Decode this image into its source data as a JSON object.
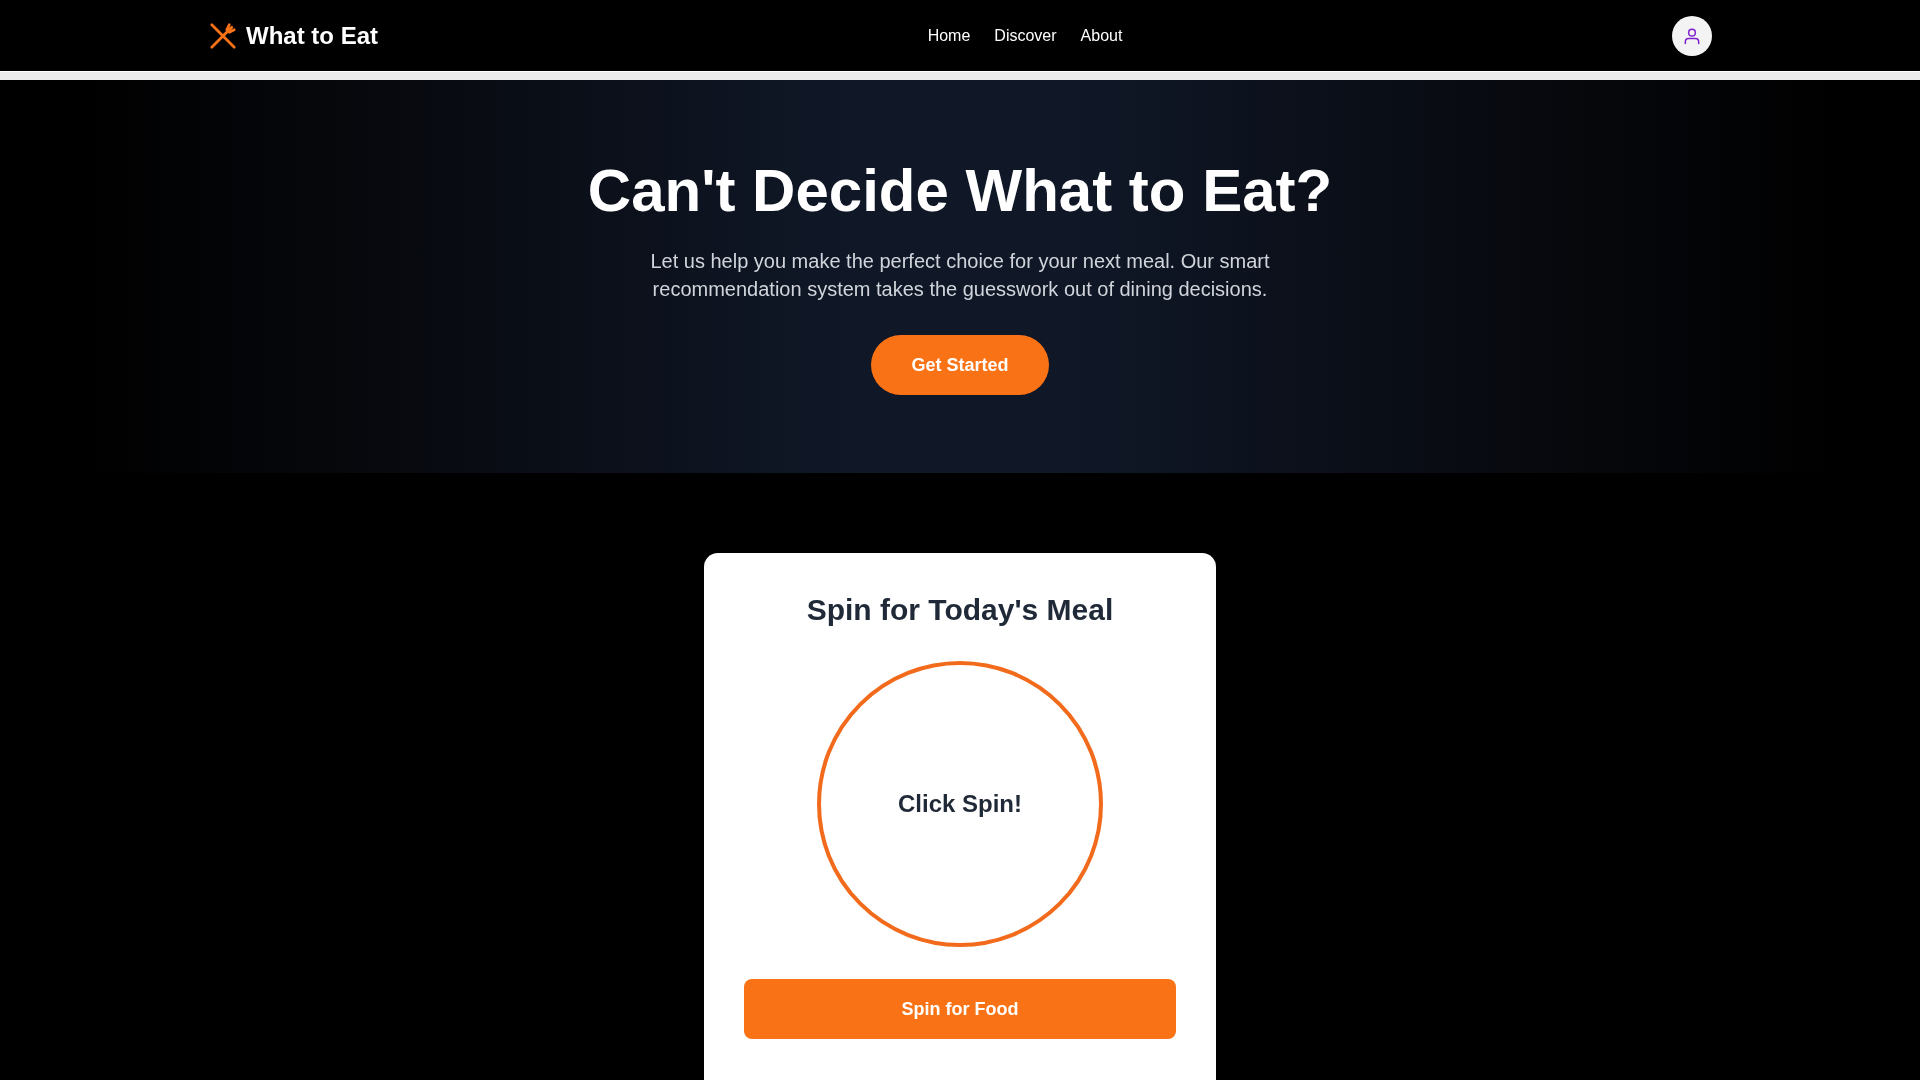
{
  "header": {
    "logo": "What to Eat",
    "nav": [
      {
        "label": "Home"
      },
      {
        "label": "Discover"
      },
      {
        "label": "About"
      }
    ]
  },
  "hero": {
    "title": "Can't Decide What to Eat?",
    "text": "Let us help you make the perfect choice for your next meal. Our smart recommendation system takes the guesswork out of dining decisions.",
    "button": "Get Started"
  },
  "spinner": {
    "title": "Spin for Today's Meal",
    "wheel_text": "Click Spin!",
    "button": "Spin for Food"
  }
}
